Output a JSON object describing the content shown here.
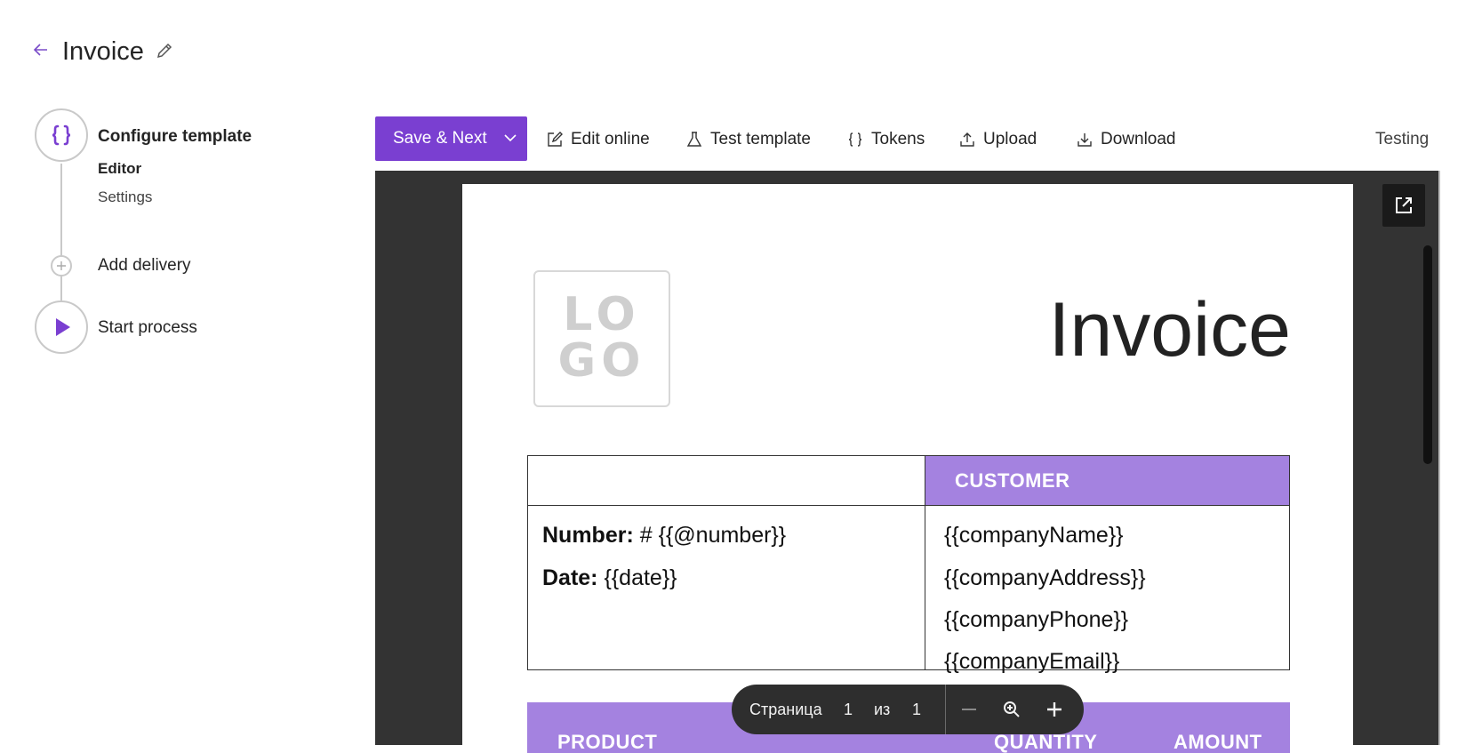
{
  "header": {
    "title": "Invoice"
  },
  "stepper": {
    "step1": {
      "label": "Configure template",
      "sub_items": [
        "Editor",
        "Settings"
      ]
    },
    "step2": {
      "label": "Add delivery"
    },
    "step3": {
      "label": "Start process"
    }
  },
  "toolbar": {
    "save_next": "Save & Next",
    "edit_online": "Edit online",
    "test_template": "Test template",
    "tokens": "Tokens",
    "upload": "Upload",
    "download": "Download",
    "testing": "Testing"
  },
  "document": {
    "logo_text": "LO\nGO",
    "title": "Invoice",
    "customer_header": "CUSTOMER",
    "number_label": "Number:",
    "number_value": " # {{@number}}",
    "date_label": "Date:",
    "date_value": " {{date}}",
    "customer_lines": [
      "{{companyName}}",
      "{{companyAddress}}",
      "{{companyPhone}}",
      "{{companyEmail}}"
    ],
    "product_columns": [
      "PRODUCT",
      "QUANTITY",
      "AMOUNT"
    ]
  },
  "pager": {
    "page_label": "Страница",
    "current_page": "1",
    "of_label": "из",
    "total_pages": "1"
  },
  "colors": {
    "accent": "#7a3fd1",
    "table_header": "#a482e0",
    "viewer_bg": "#333333"
  }
}
